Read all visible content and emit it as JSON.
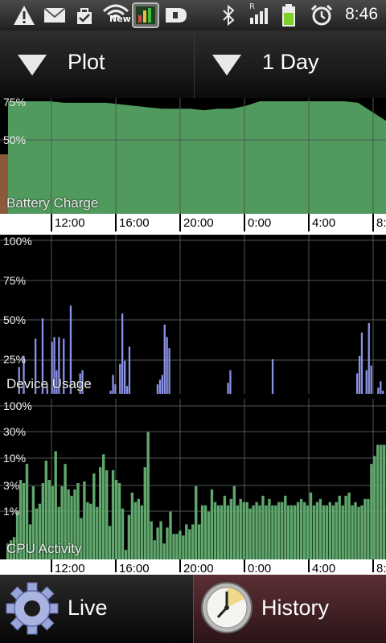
{
  "status_bar": {
    "time": "8:46",
    "wifi_badge": "New",
    "network_type": "R",
    "icons": [
      "warning-icon",
      "mail-icon",
      "task-check-icon",
      "wifi-icon",
      "battery-app-icon",
      "d-icon",
      "bluetooth-icon",
      "signal-icon",
      "battery-icon",
      "alarm-icon"
    ]
  },
  "toolbar": {
    "plot_label": "Plot",
    "range_label": "1 Day"
  },
  "time_axis": [
    "12:00",
    "16:00",
    "20:00",
    "0:00",
    "4:00",
    "8:"
  ],
  "chart_data": [
    {
      "type": "area",
      "title": "Battery Charge",
      "y_ticks": [
        "75%",
        "50%"
      ],
      "ylim": [
        0,
        100
      ],
      "color": "#4f9a5c",
      "x": [
        0,
        1,
        2,
        3,
        4,
        5,
        6,
        7,
        8,
        9,
        10,
        11,
        12,
        13,
        14,
        15,
        16,
        17,
        18,
        19,
        20,
        21,
        22,
        23,
        24,
        25,
        26,
        27
      ],
      "values": [
        75,
        75,
        75,
        75,
        74,
        74,
        74,
        74,
        73,
        72,
        71,
        70,
        70,
        70,
        69,
        70,
        70,
        72,
        75,
        75,
        75,
        75,
        75,
        75,
        75,
        74,
        68,
        62
      ]
    },
    {
      "type": "bar",
      "title": "Device Usage",
      "y_ticks": [
        "100%",
        "75%",
        "50%",
        "25%"
      ],
      "ylim": [
        0,
        100
      ],
      "color": "#8a92e6",
      "values": [
        0,
        0,
        0,
        0,
        0,
        17,
        0,
        24,
        0,
        0,
        0,
        0,
        35,
        0,
        0,
        48,
        0,
        6,
        0,
        33,
        36,
        15,
        36,
        0,
        35,
        0,
        0,
        56,
        0,
        0,
        0,
        13,
        15,
        0,
        0,
        0,
        0,
        0,
        0,
        0,
        0,
        0,
        0,
        0,
        2,
        12,
        6,
        0,
        19,
        51,
        21,
        5,
        30,
        0,
        0,
        0,
        0,
        0,
        0,
        0,
        0,
        0,
        0,
        0,
        6,
        9,
        12,
        44,
        36,
        29,
        0,
        0,
        0,
        0,
        0,
        0,
        0,
        0,
        0,
        0,
        0,
        0,
        0,
        0,
        0,
        0,
        0,
        0,
        0,
        0,
        0,
        0,
        0,
        0,
        7,
        15,
        0,
        0,
        0,
        0,
        0,
        0,
        0,
        0,
        0,
        0,
        0,
        0,
        0,
        0,
        0,
        0,
        0,
        22,
        0,
        0,
        0,
        0,
        0,
        0,
        0,
        0,
        0,
        0,
        0,
        0,
        0,
        0,
        0,
        0,
        0,
        0,
        0,
        0,
        0,
        0,
        0,
        0,
        0,
        0,
        0,
        0,
        0,
        0,
        0,
        0,
        0,
        0,
        0,
        13,
        24,
        39,
        0,
        15,
        45,
        18,
        0,
        0,
        4,
        8,
        2
      ]
    },
    {
      "type": "bar",
      "title": "CPU Activity",
      "y_ticks": [
        "100%",
        "30%",
        "10%",
        "3%",
        "1%"
      ],
      "ylim": [
        0,
        100
      ],
      "color": "#5fa76c",
      "values": [
        10,
        12,
        14,
        30,
        50,
        48,
        60,
        22,
        46,
        32,
        35,
        48,
        62,
        50,
        46,
        68,
        33,
        46,
        60,
        44,
        40,
        44,
        48,
        26,
        49,
        36,
        35,
        54,
        33,
        58,
        66,
        56,
        21,
        56,
        50,
        48,
        32,
        6,
        28,
        42,
        36,
        38,
        34,
        58,
        80,
        24,
        12,
        20,
        24,
        10,
        20,
        30,
        16,
        16,
        18,
        15,
        22,
        19,
        22,
        46,
        22,
        34,
        34,
        30,
        44,
        36,
        34,
        34,
        40,
        34,
        38,
        46,
        34,
        38,
        36,
        36,
        32,
        34,
        36,
        34,
        40,
        34,
        38,
        34,
        34,
        36,
        36,
        40,
        34,
        34,
        34,
        36,
        38,
        36,
        34,
        42,
        34,
        36,
        38,
        34,
        34,
        36,
        34,
        36,
        40,
        34,
        40,
        42,
        34,
        36,
        33,
        34,
        38,
        38,
        60,
        65,
        72,
        72,
        72
      ]
    }
  ],
  "bottom_tabs": {
    "live_label": "Live",
    "history_label": "History"
  }
}
